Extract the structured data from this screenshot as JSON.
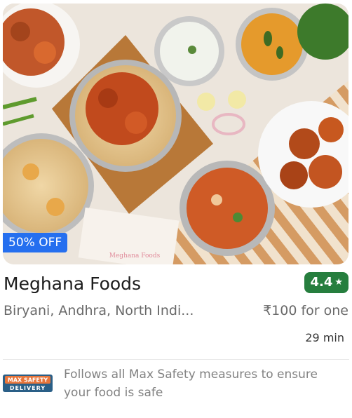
{
  "restaurant": {
    "name": "Meghana Foods",
    "rating": "4.4",
    "cuisines": "Biryani, Andhra, North Indi...",
    "price": "₹100 for one",
    "delivery_time": "29 min",
    "offer": "50% OFF",
    "watermark": "Meghana Foods"
  },
  "safety": {
    "badge_top": "MAX SAFETY",
    "badge_bottom": "DELIVERY",
    "text": "Follows all Max Safety measures to ensure your food is safe"
  },
  "icons": {
    "rating": "star-icon"
  },
  "colors": {
    "offer": "#256fef",
    "rating": "#267e3e",
    "badge": "#e8753a"
  }
}
